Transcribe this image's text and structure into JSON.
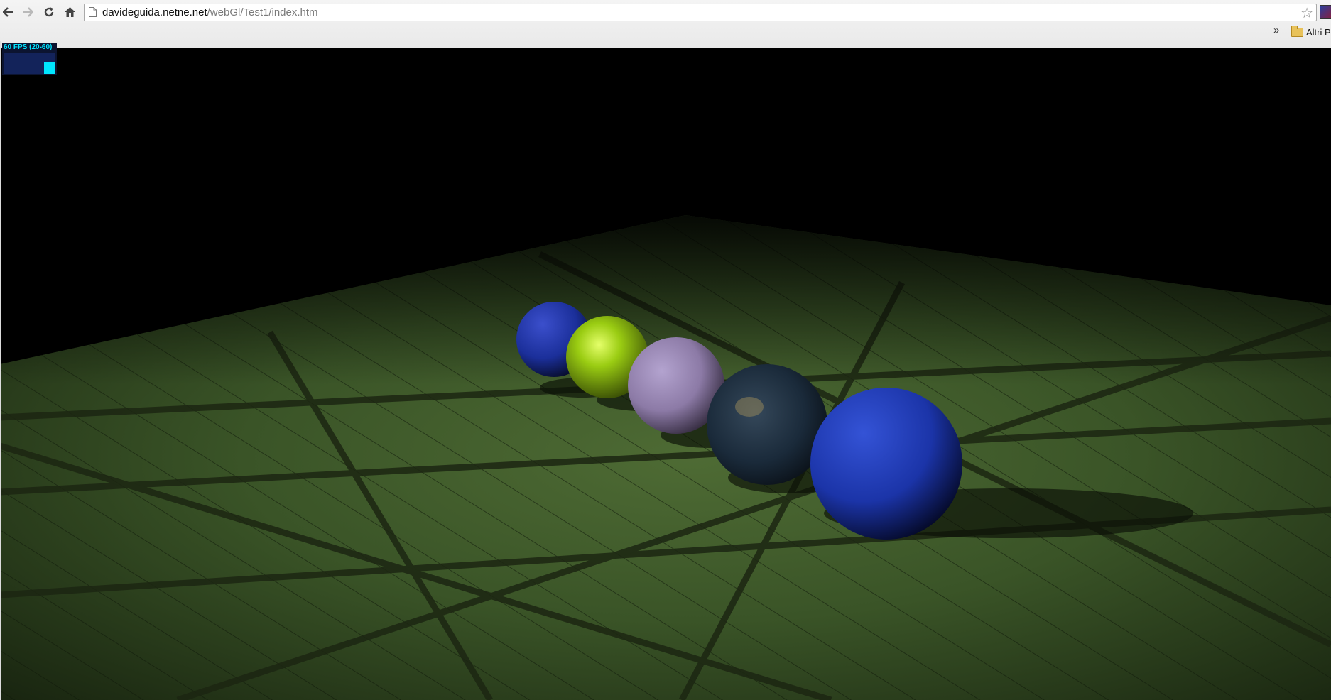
{
  "browser": {
    "url_host": "davideguida.netne.net",
    "url_path": "/webGl/Test1/index.htm",
    "bookmarks_overflow": "»",
    "bookmark_folder_label": "Altri Pr"
  },
  "icons": {
    "back": "back-arrow-icon",
    "forward": "forward-arrow-icon",
    "reload": "reload-icon",
    "home": "home-icon",
    "star": "bookmark-star-icon",
    "folder": "folder-icon"
  },
  "stats": {
    "fps_label": "60 FPS (20-60)",
    "fps_level": 0.6
  },
  "scene": {
    "floor_color": "#3f5a2a",
    "spheres": [
      {
        "color": "#1b2f9a"
      },
      {
        "color": "#9acc12"
      },
      {
        "color": "#8c7aa6"
      },
      {
        "color": "#1a2a3a"
      },
      {
        "color": "#1b34a8"
      }
    ]
  }
}
